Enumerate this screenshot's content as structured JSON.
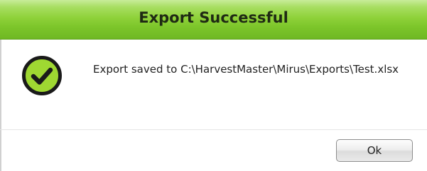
{
  "dialog": {
    "title": "Export Successful",
    "message": "Export saved to C:\\HarvestMaster\\Mirus\\Exports\\Test.xlsx",
    "ok_label": "Ok",
    "icon": "check-circle-icon"
  },
  "colors": {
    "title_bar_light": "#c8ec9a",
    "title_bar_dark": "#6fb823",
    "icon_fill": "#9fd832",
    "icon_ring": "#1a1a1a"
  }
}
